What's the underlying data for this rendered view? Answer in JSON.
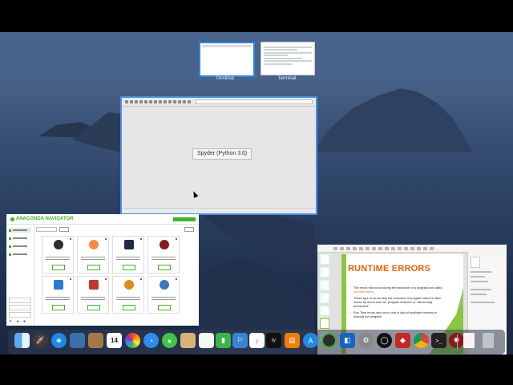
{
  "mission_control": {
    "spaces": [
      {
        "label": "Desktop",
        "selected": true
      },
      {
        "label": "Terminal",
        "selected": false
      }
    ]
  },
  "windows": {
    "spyder": {
      "label": "Spyder (Python 3.6)"
    },
    "anaconda": {
      "title": "ANACONDA NAVIGATOR"
    },
    "powerpoint": {
      "slide_title": "RUNTIME ERRORS",
      "bullets": [
        {
          "parts": [
            "The errors that occur during the execution of a program are called ",
            "run time errors",
            "."
          ]
        },
        {
          "parts": [
            "These type of errors stop the execution of program which is often known by terms such as “program crashed” or “abnormally terminated”."
          ]
        },
        {
          "parts": [
            "Run Time errors also occur due to lack of available memory to execute the program."
          ]
        }
      ]
    }
  },
  "dock": {
    "calendar_day": "14",
    "icons": [
      "finder-icon",
      "launchpad-icon",
      "safari-icon",
      "preview-icon",
      "notes-icon",
      "calendar-icon",
      "photos-icon",
      "facetime-icon",
      "messages-icon",
      "contacts-icon",
      "numbers-icon",
      "keynote-icon",
      "music-icon",
      "tv-icon",
      "books-icon",
      "app-store-icon",
      "anaconda-icon",
      "system-preferences-icon",
      "activity-icon",
      "zoom-icon",
      "remote-desktop-icon",
      "chrome-icon",
      "terminal-icon",
      "spyder-icon",
      "document-icon",
      "trash-icon"
    ]
  },
  "colors": {
    "accent": "#2d84e8",
    "anaconda_green": "#43b02a",
    "ppt_orange": "#e8610c",
    "ppt_green": "#8cc63f"
  }
}
